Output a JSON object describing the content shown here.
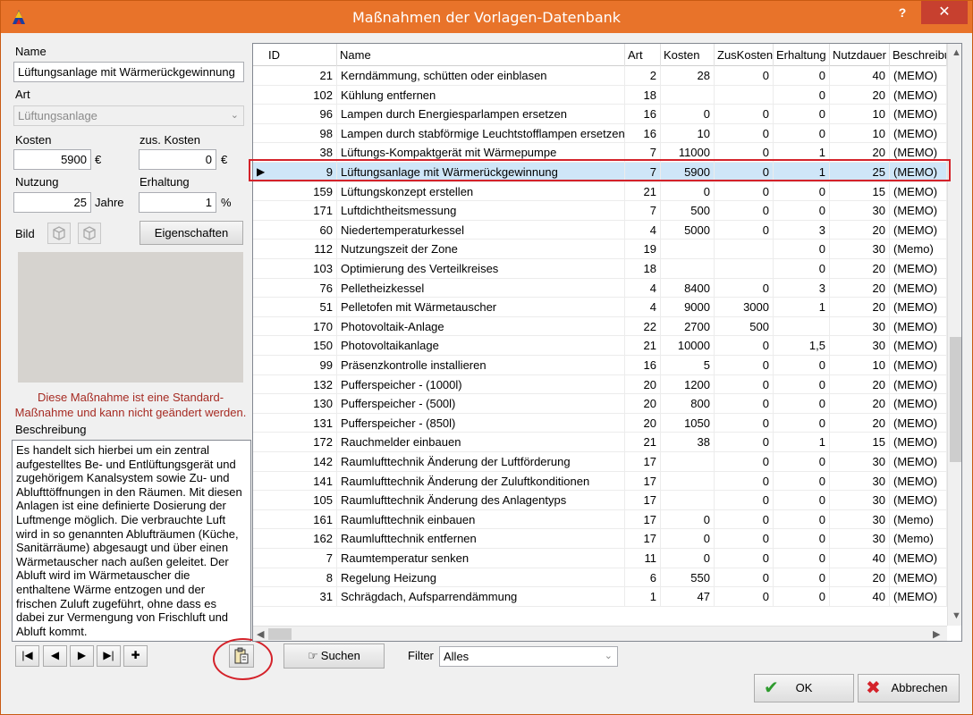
{
  "window": {
    "title": "Maßnahmen der Vorlagen-Datenbank",
    "help_label": "?",
    "close_label": "✕"
  },
  "form": {
    "name_label": "Name",
    "name_value": "Lüftungsanlage mit Wärmerückgewinnung",
    "art_label": "Art",
    "art_value": "Lüftungsanlage",
    "kosten_label": "Kosten",
    "kosten_value": "5900",
    "kosten_unit": "€",
    "zus_kosten_label": "zus. Kosten",
    "zus_kosten_value": "0",
    "zus_kosten_unit": "€",
    "nutzung_label": "Nutzung",
    "nutzung_value": "25",
    "nutzung_unit": "Jahre",
    "erhaltung_label": "Erhaltung",
    "erhaltung_value": "1",
    "erhaltung_unit": "%",
    "bild_label": "Bild",
    "eigenschaften_label": "Eigenschaften",
    "standard_message": "Diese Maßnahme ist eine Standard-Maßnahme und kann nicht geändert werden.",
    "beschreibung_label": "Beschreibung",
    "beschreibung_text": "Es handelt sich hierbei um ein zentral aufgestelltes Be- und Entlüftungsgerät und zugehörigem Kanalsystem sowie Zu- und Ablufttöffnungen in den Räumen. Mit diesen Anlagen ist eine definierte Dosierung der Luftmenge möglich. Die verbrauchte Luft wird in so genannten Ablufträumen (Küche, Sanitärräume) abgesaugt und über einen Wärmetauscher  nach außen geleitet. Der Abluft wird im Wärmetauscher die enthaltene Wärme entzogen und der frischen Zuluft zugeführt, ohne dass es dabei zur Vermengung von Frischluft und Abluft kommt."
  },
  "nav": {
    "first": "|◀",
    "prev": "◀",
    "next": "▶",
    "last": "▶|",
    "add": "✚"
  },
  "bottom": {
    "suchen_label": "Suchen",
    "filter_label": "Filter",
    "filter_value": "Alles",
    "ok_label": "OK",
    "abbrechen_label": "Abbrechen"
  },
  "grid": {
    "columns": [
      "ID",
      "Name",
      "Art",
      "Kosten",
      "ZusKosten",
      "Erhaltung",
      "Nutzdauer",
      "Beschreibu"
    ],
    "selected_index": 5,
    "rows": [
      [
        "21",
        "Kerndämmung, schütten oder einblasen",
        "2",
        "28",
        "0",
        "0",
        "40",
        "(MEMO)"
      ],
      [
        "102",
        "Kühlung entfernen",
        "18",
        "",
        "",
        "0",
        "20",
        "(MEMO)"
      ],
      [
        "96",
        "Lampen durch Energiesparlampen ersetzen",
        "16",
        "0",
        "0",
        "0",
        "10",
        "(MEMO)"
      ],
      [
        "98",
        "Lampen durch stabförmige Leuchtstofflampen ersetzen",
        "16",
        "10",
        "0",
        "0",
        "10",
        "(MEMO)"
      ],
      [
        "38",
        "Lüftungs-Kompaktgerät mit Wärmepumpe",
        "7",
        "11000",
        "0",
        "1",
        "20",
        "(MEMO)"
      ],
      [
        "9",
        "Lüftungsanlage mit Wärmerückgewinnung",
        "7",
        "5900",
        "0",
        "1",
        "25",
        "(MEMO)"
      ],
      [
        "159",
        "Lüftungskonzept erstellen",
        "21",
        "0",
        "0",
        "0",
        "15",
        "(MEMO)"
      ],
      [
        "171",
        "Luftdichtheitsmessung",
        "7",
        "500",
        "0",
        "0",
        "30",
        "(MEMO)"
      ],
      [
        "60",
        "Niedertemperaturkessel",
        "4",
        "5000",
        "0",
        "3",
        "20",
        "(MEMO)"
      ],
      [
        "112",
        "Nutzungszeit der Zone",
        "19",
        "",
        "",
        "0",
        "30",
        "(Memo)"
      ],
      [
        "103",
        "Optimierung des Verteilkreises",
        "18",
        "",
        "",
        "0",
        "20",
        "(MEMO)"
      ],
      [
        "76",
        "Pelletheizkessel",
        "4",
        "8400",
        "0",
        "3",
        "20",
        "(MEMO)"
      ],
      [
        "51",
        "Pelletofen mit Wärmetauscher",
        "4",
        "9000",
        "3000",
        "1",
        "20",
        "(MEMO)"
      ],
      [
        "170",
        "Photovoltaik-Anlage",
        "22",
        "2700",
        "500",
        "",
        "30",
        "(MEMO)"
      ],
      [
        "150",
        "Photovoltaikanlage",
        "21",
        "10000",
        "0",
        "1,5",
        "30",
        "(MEMO)"
      ],
      [
        "99",
        "Präsenzkontrolle installieren",
        "16",
        "5",
        "0",
        "0",
        "10",
        "(MEMO)"
      ],
      [
        "132",
        "Pufferspeicher - (1000l)",
        "20",
        "1200",
        "0",
        "0",
        "20",
        "(MEMO)"
      ],
      [
        "130",
        "Pufferspeicher - (500l)",
        "20",
        "800",
        "0",
        "0",
        "20",
        "(MEMO)"
      ],
      [
        "131",
        "Pufferspeicher - (850l)",
        "20",
        "1050",
        "0",
        "0",
        "20",
        "(MEMO)"
      ],
      [
        "172",
        "Rauchmelder einbauen",
        "21",
        "38",
        "0",
        "1",
        "15",
        "(MEMO)"
      ],
      [
        "142",
        "Raumlufttechnik Änderung der Luftförderung",
        "17",
        "",
        "0",
        "0",
        "30",
        "(MEMO)"
      ],
      [
        "141",
        "Raumlufttechnik Änderung der Zuluftkonditionen",
        "17",
        "",
        "0",
        "0",
        "30",
        "(MEMO)"
      ],
      [
        "105",
        "Raumlufttechnik Änderung des Anlagentyps",
        "17",
        "",
        "0",
        "0",
        "30",
        "(MEMO)"
      ],
      [
        "161",
        "Raumlufttechnik einbauen",
        "17",
        "0",
        "0",
        "0",
        "30",
        "(Memo)"
      ],
      [
        "162",
        "Raumlufttechnik entfernen",
        "17",
        "0",
        "0",
        "0",
        "30",
        "(Memo)"
      ],
      [
        "7",
        "Raumtemperatur senken",
        "11",
        "0",
        "0",
        "0",
        "40",
        "(MEMO)"
      ],
      [
        "8",
        "Regelung Heizung",
        "6",
        "550",
        "0",
        "0",
        "20",
        "(MEMO)"
      ],
      [
        "31",
        "Schrägdach, Aufsparrendämmung",
        "1",
        "47",
        "0",
        "0",
        "40",
        "(MEMO)"
      ]
    ]
  }
}
